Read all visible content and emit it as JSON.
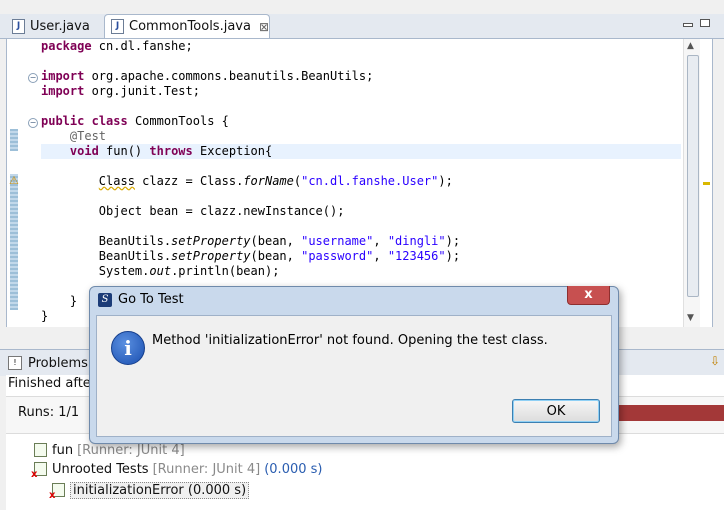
{
  "editor_tabs": [
    {
      "label": "User.java",
      "active": false
    },
    {
      "label": "CommonTools.java",
      "active": true,
      "close": "⊠"
    }
  ],
  "code_lines": [
    "package cn.dl.fanshe;",
    "",
    "import org.apache.commons.beanutils.BeanUtils;",
    "import org.junit.Test;",
    "",
    "public class CommonTools {",
    "    @Test",
    "    void fun() throws Exception{",
    "",
    "        Class clazz = Class.forName(\"cn.dl.fanshe.User\");",
    "",
    "        Object bean = clazz.newInstance();",
    "",
    "        BeanUtils.setProperty(bean, \"username\", \"dingli\");",
    "        BeanUtils.setProperty(bean, \"password\", \"123456\");",
    "        System.out.println(bean);",
    "",
    "    }",
    "}"
  ],
  "views": {
    "problems_tab": "Problems",
    "junit_status": "Finished after",
    "runs": "Runs:  1/1",
    "colors": {
      "failure_bar": "#a33838",
      "accent": "#3c7fb1"
    }
  },
  "test_tree": [
    {
      "name": "fun",
      "runner": "[Runner: JUnit 4]",
      "time": "",
      "icon": "test-icon"
    },
    {
      "name": "Unrooted Tests",
      "runner": "[Runner: JUnit 4]",
      "time": "(0.000 s)",
      "icon": "error-suite-icon"
    },
    {
      "name": "initializationError (0.000 s)",
      "runner": "",
      "time": "",
      "icon": "error-test-icon"
    }
  ],
  "dialog": {
    "title": "Go To Test",
    "message": "Method 'initializationError' not found. Opening the test class.",
    "ok_label": "OK",
    "close_glyph": "x"
  }
}
